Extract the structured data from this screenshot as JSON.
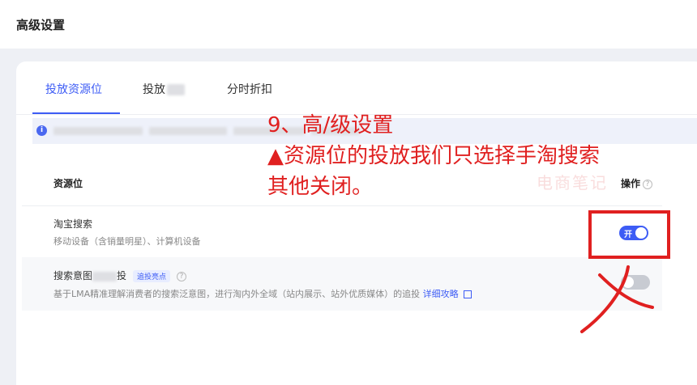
{
  "page": {
    "title": "高级设置"
  },
  "tabs": [
    {
      "label": "投放资源位",
      "active": true
    },
    {
      "label": "投放",
      "blurred_suffix": true
    },
    {
      "label": "分时折扣"
    }
  ],
  "table": {
    "header_resource": "资源位",
    "header_action": "操作",
    "rows": [
      {
        "title": "淘宝搜索",
        "sub": "移动设备（含销量明星）、计算机设备",
        "switch_label": "开",
        "enabled": true
      },
      {
        "title_prefix": "搜索意图",
        "title_suffix": "投",
        "tag": "追投亮点",
        "sub": "基于LMA精准理解消费者的搜索泛意图，进行淘内外全域（站内展示、站外优质媒体）的追投",
        "link": "详细攻略",
        "enabled": false
      }
    ]
  },
  "annotation": {
    "line1": "9、高/级设置",
    "line2": "▲资源位的投放我们只选择手淘搜索",
    "line3": "其他关闭。"
  },
  "watermark": "电商笔记",
  "colors": {
    "accent": "#3d5cf5",
    "annotation": "#e02020",
    "switch_off": "#c8cbd2"
  }
}
